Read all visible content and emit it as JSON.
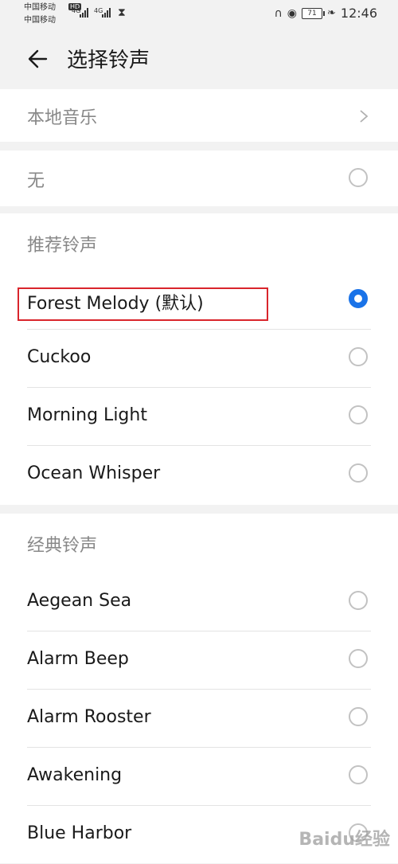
{
  "status_bar": {
    "carrier1": "中国移动",
    "carrier2": "中国移动",
    "hd": "HD",
    "net1": "4G",
    "net2": "4G",
    "battery": "71",
    "time": "12:46"
  },
  "app_bar": {
    "title": "选择铃声"
  },
  "local_music": {
    "label": "本地音乐"
  },
  "none_option": {
    "label": "无"
  },
  "recommended": {
    "title": "推荐铃声",
    "items": [
      {
        "label": "Forest Melody (默认)",
        "selected": true
      },
      {
        "label": "Cuckoo",
        "selected": false
      },
      {
        "label": "Morning Light",
        "selected": false
      },
      {
        "label": "Ocean Whisper",
        "selected": false
      }
    ]
  },
  "classic": {
    "title": "经典铃声",
    "items": [
      {
        "label": "Aegean Sea",
        "selected": false
      },
      {
        "label": "Alarm Beep",
        "selected": false
      },
      {
        "label": "Alarm Rooster",
        "selected": false
      },
      {
        "label": "Awakening",
        "selected": false
      },
      {
        "label": "Blue Harbor",
        "selected": false
      }
    ]
  },
  "watermark": "Baidu经验",
  "colors": {
    "accent": "#1a73e8",
    "highlight": "#d9252c"
  }
}
